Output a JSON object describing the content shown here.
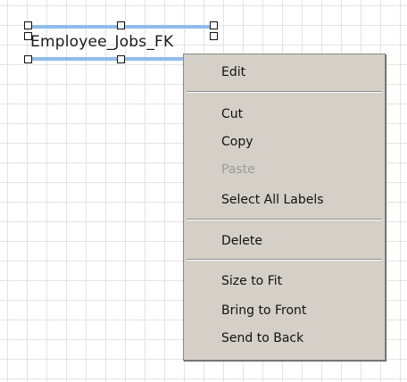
{
  "diagram": {
    "label_text": "Employee_Jobs_FK"
  },
  "context_menu": {
    "edit": "Edit",
    "cut": "Cut",
    "copy": "Copy",
    "paste": "Paste",
    "select_all_labels": "Select All Labels",
    "delete": "Delete",
    "size_to_fit": "Size to Fit",
    "bring_to_front": "Bring to Front",
    "send_to_back": "Send to Back"
  },
  "state": {
    "paste_enabled": false
  },
  "colors": {
    "canvas_background": "#ffffff",
    "grid_line": "#e3e3e3",
    "selection_line": "#8fbcea",
    "menu_background": "#d4d0c8",
    "disabled_text": "#9a9a9a"
  }
}
